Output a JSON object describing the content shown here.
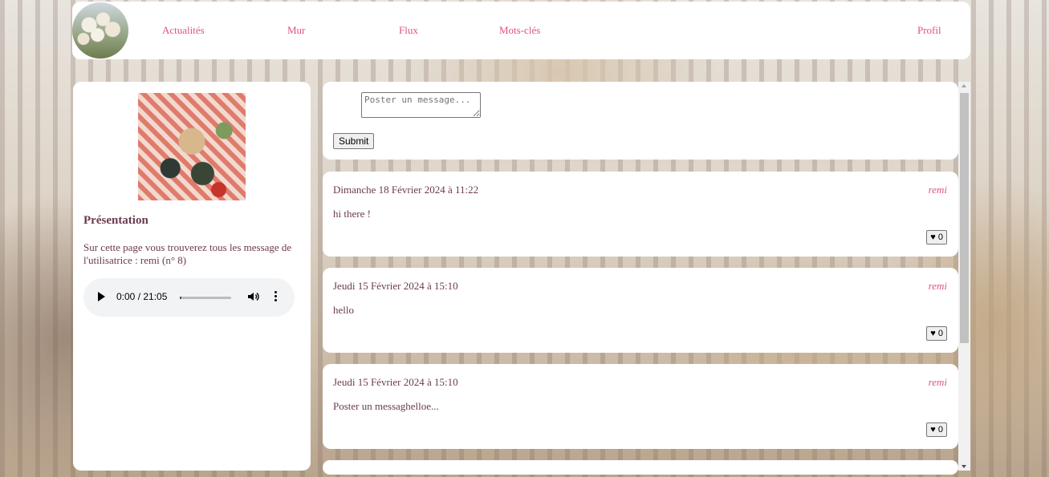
{
  "nav": {
    "links": [
      "Actualités",
      "Mur",
      "Flux",
      "Mots-clés"
    ],
    "profile": "Profil"
  },
  "sidebar": {
    "title": "Présentation",
    "text": "Sur cette page vous trouverez tous les message de l'utilisatrice : remi (n° 8)",
    "audio": {
      "time": "0:00 / 21:05"
    }
  },
  "composer": {
    "placeholder": "Poster un message...",
    "submit": "Submit"
  },
  "posts": [
    {
      "date": "Dimanche 18 Février 2024 à 11:22",
      "author": "remi",
      "content": "hi there !",
      "likes": "♥ 0"
    },
    {
      "date": "Jeudi 15 Février 2024 à 15:10",
      "author": "remi",
      "content": "hello",
      "likes": "♥ 0"
    },
    {
      "date": "Jeudi 15 Février 2024 à 15:10",
      "author": "remi",
      "content": "Poster un messaghelloe...",
      "likes": "♥ 0"
    }
  ],
  "colors": {
    "accent": "#e0537a",
    "text": "#6b3a50"
  }
}
